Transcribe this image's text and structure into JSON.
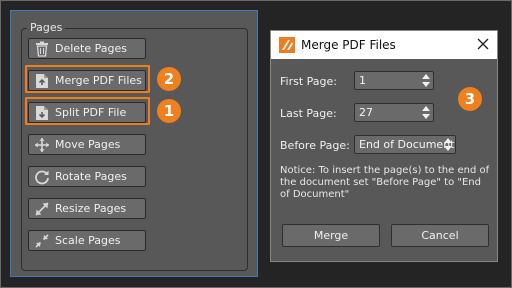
{
  "pages_panel": {
    "legend": "Pages",
    "buttons": [
      {
        "label": "Delete Pages",
        "icon": "trash-icon"
      },
      {
        "label": "Merge PDF Files",
        "icon": "merge-document-icon"
      },
      {
        "label": "Split PDF File",
        "icon": "split-document-icon"
      },
      {
        "label": "Move Pages",
        "icon": "move-arrows-icon"
      },
      {
        "label": "Rotate Pages",
        "icon": "rotate-icon"
      },
      {
        "label": "Resize Pages",
        "icon": "resize-icon"
      },
      {
        "label": "Scale Pages",
        "icon": "scale-icon"
      }
    ]
  },
  "callouts": {
    "merge": "2",
    "split": "1",
    "dialog": "3"
  },
  "dialog": {
    "title": "Merge PDF Files",
    "first_page_label": "First Page:",
    "first_page_value": "1",
    "last_page_label": "Last Page:",
    "last_page_value": "27",
    "before_page_label": "Before Page:",
    "before_page_value": "End of Document",
    "notice": "Notice: To insert the page(s) to the end of the document set \"Before Page\" to \"End of Document\"",
    "merge_label": "Merge",
    "cancel_label": "Cancel"
  },
  "colors": {
    "accent": "#f07f1e",
    "panel": "#585858",
    "button": "#6a6a6a",
    "panel_border": "#3d7bbf"
  }
}
